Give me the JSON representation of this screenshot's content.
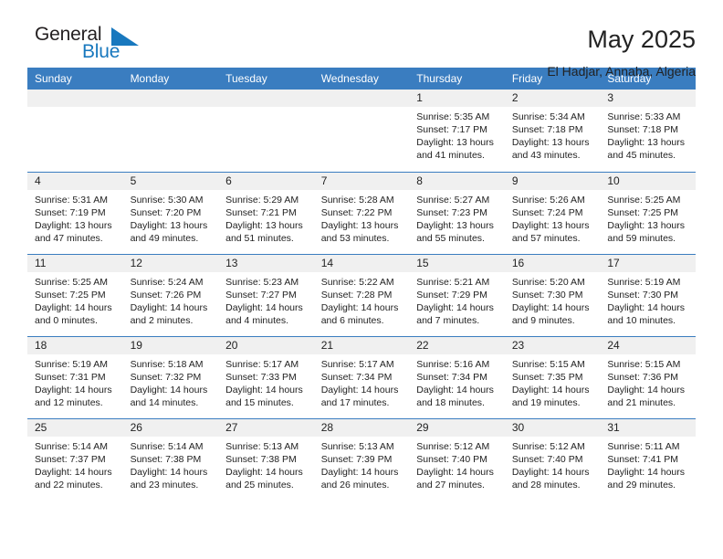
{
  "brand": {
    "name_part1": "General",
    "name_part2": "Blue",
    "flag_color": "#1878be",
    "text_color": "#231f20"
  },
  "header": {
    "title": "May 2025",
    "location": "El Hadjar, Annaba, Algeria"
  },
  "theme": {
    "header_bar": "#3a7dc0",
    "daynum_band": "#f0f0f0",
    "row_rule": "#3a7dc0"
  },
  "weekday_headers": [
    "Sunday",
    "Monday",
    "Tuesday",
    "Wednesday",
    "Thursday",
    "Friday",
    "Saturday"
  ],
  "labels": {
    "sunrise_prefix": "Sunrise: ",
    "sunset_prefix": "Sunset: ",
    "daylight_prefix": "Daylight: "
  },
  "weeks": [
    [
      {
        "day": "",
        "empty": true
      },
      {
        "day": "",
        "empty": true
      },
      {
        "day": "",
        "empty": true
      },
      {
        "day": "",
        "empty": true
      },
      {
        "day": "1",
        "sunrise": "Sunrise: 5:35 AM",
        "sunset": "Sunset: 7:17 PM",
        "daylight": "Daylight: 13 hours and 41 minutes."
      },
      {
        "day": "2",
        "sunrise": "Sunrise: 5:34 AM",
        "sunset": "Sunset: 7:18 PM",
        "daylight": "Daylight: 13 hours and 43 minutes."
      },
      {
        "day": "3",
        "sunrise": "Sunrise: 5:33 AM",
        "sunset": "Sunset: 7:18 PM",
        "daylight": "Daylight: 13 hours and 45 minutes."
      }
    ],
    [
      {
        "day": "4",
        "sunrise": "Sunrise: 5:31 AM",
        "sunset": "Sunset: 7:19 PM",
        "daylight": "Daylight: 13 hours and 47 minutes."
      },
      {
        "day": "5",
        "sunrise": "Sunrise: 5:30 AM",
        "sunset": "Sunset: 7:20 PM",
        "daylight": "Daylight: 13 hours and 49 minutes."
      },
      {
        "day": "6",
        "sunrise": "Sunrise: 5:29 AM",
        "sunset": "Sunset: 7:21 PM",
        "daylight": "Daylight: 13 hours and 51 minutes."
      },
      {
        "day": "7",
        "sunrise": "Sunrise: 5:28 AM",
        "sunset": "Sunset: 7:22 PM",
        "daylight": "Daylight: 13 hours and 53 minutes."
      },
      {
        "day": "8",
        "sunrise": "Sunrise: 5:27 AM",
        "sunset": "Sunset: 7:23 PM",
        "daylight": "Daylight: 13 hours and 55 minutes."
      },
      {
        "day": "9",
        "sunrise": "Sunrise: 5:26 AM",
        "sunset": "Sunset: 7:24 PM",
        "daylight": "Daylight: 13 hours and 57 minutes."
      },
      {
        "day": "10",
        "sunrise": "Sunrise: 5:25 AM",
        "sunset": "Sunset: 7:25 PM",
        "daylight": "Daylight: 13 hours and 59 minutes."
      }
    ],
    [
      {
        "day": "11",
        "sunrise": "Sunrise: 5:25 AM",
        "sunset": "Sunset: 7:25 PM",
        "daylight": "Daylight: 14 hours and 0 minutes."
      },
      {
        "day": "12",
        "sunrise": "Sunrise: 5:24 AM",
        "sunset": "Sunset: 7:26 PM",
        "daylight": "Daylight: 14 hours and 2 minutes."
      },
      {
        "day": "13",
        "sunrise": "Sunrise: 5:23 AM",
        "sunset": "Sunset: 7:27 PM",
        "daylight": "Daylight: 14 hours and 4 minutes."
      },
      {
        "day": "14",
        "sunrise": "Sunrise: 5:22 AM",
        "sunset": "Sunset: 7:28 PM",
        "daylight": "Daylight: 14 hours and 6 minutes."
      },
      {
        "day": "15",
        "sunrise": "Sunrise: 5:21 AM",
        "sunset": "Sunset: 7:29 PM",
        "daylight": "Daylight: 14 hours and 7 minutes."
      },
      {
        "day": "16",
        "sunrise": "Sunrise: 5:20 AM",
        "sunset": "Sunset: 7:30 PM",
        "daylight": "Daylight: 14 hours and 9 minutes."
      },
      {
        "day": "17",
        "sunrise": "Sunrise: 5:19 AM",
        "sunset": "Sunset: 7:30 PM",
        "daylight": "Daylight: 14 hours and 10 minutes."
      }
    ],
    [
      {
        "day": "18",
        "sunrise": "Sunrise: 5:19 AM",
        "sunset": "Sunset: 7:31 PM",
        "daylight": "Daylight: 14 hours and 12 minutes."
      },
      {
        "day": "19",
        "sunrise": "Sunrise: 5:18 AM",
        "sunset": "Sunset: 7:32 PM",
        "daylight": "Daylight: 14 hours and 14 minutes."
      },
      {
        "day": "20",
        "sunrise": "Sunrise: 5:17 AM",
        "sunset": "Sunset: 7:33 PM",
        "daylight": "Daylight: 14 hours and 15 minutes."
      },
      {
        "day": "21",
        "sunrise": "Sunrise: 5:17 AM",
        "sunset": "Sunset: 7:34 PM",
        "daylight": "Daylight: 14 hours and 17 minutes."
      },
      {
        "day": "22",
        "sunrise": "Sunrise: 5:16 AM",
        "sunset": "Sunset: 7:34 PM",
        "daylight": "Daylight: 14 hours and 18 minutes."
      },
      {
        "day": "23",
        "sunrise": "Sunrise: 5:15 AM",
        "sunset": "Sunset: 7:35 PM",
        "daylight": "Daylight: 14 hours and 19 minutes."
      },
      {
        "day": "24",
        "sunrise": "Sunrise: 5:15 AM",
        "sunset": "Sunset: 7:36 PM",
        "daylight": "Daylight: 14 hours and 21 minutes."
      }
    ],
    [
      {
        "day": "25",
        "sunrise": "Sunrise: 5:14 AM",
        "sunset": "Sunset: 7:37 PM",
        "daylight": "Daylight: 14 hours and 22 minutes."
      },
      {
        "day": "26",
        "sunrise": "Sunrise: 5:14 AM",
        "sunset": "Sunset: 7:38 PM",
        "daylight": "Daylight: 14 hours and 23 minutes."
      },
      {
        "day": "27",
        "sunrise": "Sunrise: 5:13 AM",
        "sunset": "Sunset: 7:38 PM",
        "daylight": "Daylight: 14 hours and 25 minutes."
      },
      {
        "day": "28",
        "sunrise": "Sunrise: 5:13 AM",
        "sunset": "Sunset: 7:39 PM",
        "daylight": "Daylight: 14 hours and 26 minutes."
      },
      {
        "day": "29",
        "sunrise": "Sunrise: 5:12 AM",
        "sunset": "Sunset: 7:40 PM",
        "daylight": "Daylight: 14 hours and 27 minutes."
      },
      {
        "day": "30",
        "sunrise": "Sunrise: 5:12 AM",
        "sunset": "Sunset: 7:40 PM",
        "daylight": "Daylight: 14 hours and 28 minutes."
      },
      {
        "day": "31",
        "sunrise": "Sunrise: 5:11 AM",
        "sunset": "Sunset: 7:41 PM",
        "daylight": "Daylight: 14 hours and 29 minutes."
      }
    ]
  ]
}
